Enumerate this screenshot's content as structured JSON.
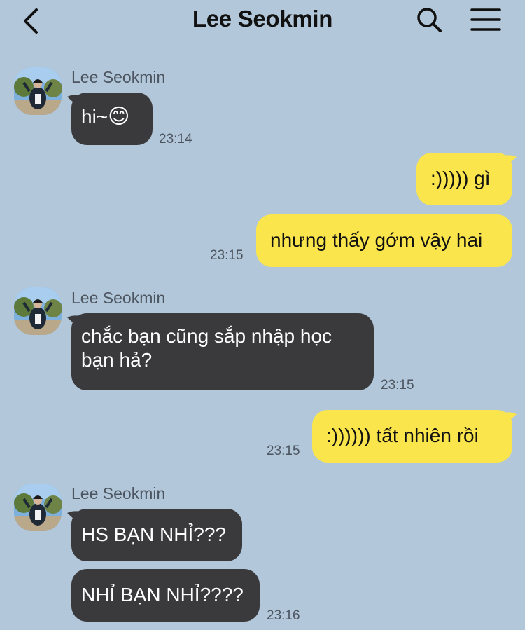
{
  "header": {
    "title": "Lee Seokmin",
    "back_icon": "chevron-left-icon",
    "search_icon": "search-icon",
    "menu_icon": "hamburger-menu-icon"
  },
  "colors": {
    "background": "#b2c7d9",
    "received_bubble": "#3a3a3c",
    "sent_bubble": "#fae54d"
  },
  "messages": {
    "g1": {
      "sender": "Lee Seokmin",
      "text1": "hi~",
      "emoji": "😊",
      "time": "23:14"
    },
    "s1": {
      "text": ":))))) gì"
    },
    "s2": {
      "text": "nhưng thấy gớm vậy hai",
      "time": "23:15"
    },
    "g2": {
      "sender": "Lee Seokmin",
      "text": "chắc bạn cũng sắp nhập học bạn hả?",
      "time": "23:15"
    },
    "s3": {
      "text": ":)))))) tất nhiên rồi",
      "time": "23:15"
    },
    "g3": {
      "sender": "Lee Seokmin",
      "text1": "HS BẠN NHỈ???",
      "text2": "NHỈ BẠN NHỈ????",
      "time": "23:16"
    }
  }
}
